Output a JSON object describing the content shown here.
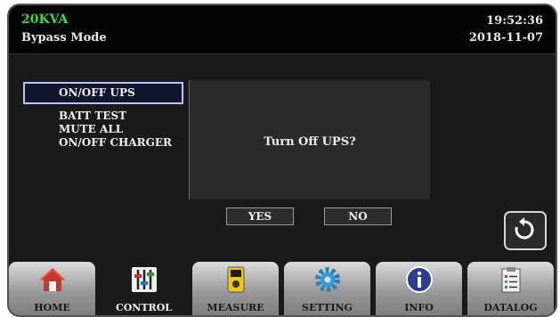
{
  "header": {
    "model": "20KVA",
    "mode": "Bypass Mode",
    "time": "19:52:36",
    "date": "2018-11-07"
  },
  "menu": {
    "items": [
      {
        "label": "ON/OFF UPS",
        "selected": true
      },
      {
        "label": "BATT TEST"
      },
      {
        "label": "MUTE ALL"
      },
      {
        "label": "ON/OFF CHARGER"
      }
    ]
  },
  "dialog": {
    "message": "Turn Off UPS?",
    "yes_label": "YES",
    "no_label": "NO"
  },
  "nav": {
    "tabs": [
      {
        "label": "HOME",
        "icon": "house-icon"
      },
      {
        "label": "CONTROL",
        "icon": "sliders-icon",
        "active": true
      },
      {
        "label": "MEASURE",
        "icon": "meter-icon"
      },
      {
        "label": "SETTING",
        "icon": "gear-icon"
      },
      {
        "label": "INFO",
        "icon": "info-icon"
      },
      {
        "label": "DATALOG",
        "icon": "clipboard-icon"
      }
    ]
  },
  "colors": {
    "model_text": "#39d84a",
    "selected_border": "#b8c4ff",
    "background": "#1a1a1a"
  }
}
